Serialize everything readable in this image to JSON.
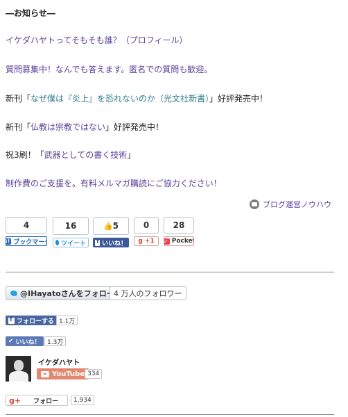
{
  "notice": {
    "heading": "―お知らせ―",
    "profile_link": "イケダハヤトってそもそも誰？（プロフィール）",
    "questions_link": "質問募集中！なんでも答えます。匿名での質問も歓迎。",
    "book1_prefix": "新刊「",
    "book1_title": "なぜ僕は『炎上』を恐れないのか（光文社新書）",
    "book1_suffix": "」好評発売中！",
    "book2_prefix": "新刊「",
    "book2_title": "仏教は宗教ではない",
    "book2_suffix": "」好評発売中！",
    "book3_prefix": "祝3刷！「",
    "book3_title": "武器としての書く技術",
    "book3_suffix": "」",
    "support_link": "制作費のご支援を。有料メルマガ購読にご協力ください！"
  },
  "category": {
    "icon": "folder-icon",
    "label": "ブログ運営ノウハウ"
  },
  "share": {
    "hatena": {
      "count": "4",
      "label": "ブックマーク",
      "badge": "B!"
    },
    "twitter": {
      "count": "16",
      "label": "ツイート"
    },
    "facebook": {
      "count": "5",
      "label": "いいね！"
    },
    "gplus": {
      "count": "0",
      "label": "+1",
      "badge": "g"
    },
    "pocket": {
      "count": "28",
      "label": "Pocket"
    }
  },
  "follow": {
    "twitter_button": "@IHayatoさんをフォロー",
    "twitter_count": "4 万人のフォロワー",
    "facebook_button": "フォローする",
    "facebook_count": "1.1万",
    "like_button": "いいね！",
    "like_count": "1.3万",
    "youtube_name": "イケダハヤト",
    "youtube_button": "YouTube",
    "youtube_count": "334",
    "gplus_button": "フォロー",
    "gplus_count": "1,934"
  },
  "colors": {
    "link": "#5a3f9b",
    "teal": "#2a7a8a",
    "facebook": "#3b5998",
    "youtube": "#e5866e"
  }
}
